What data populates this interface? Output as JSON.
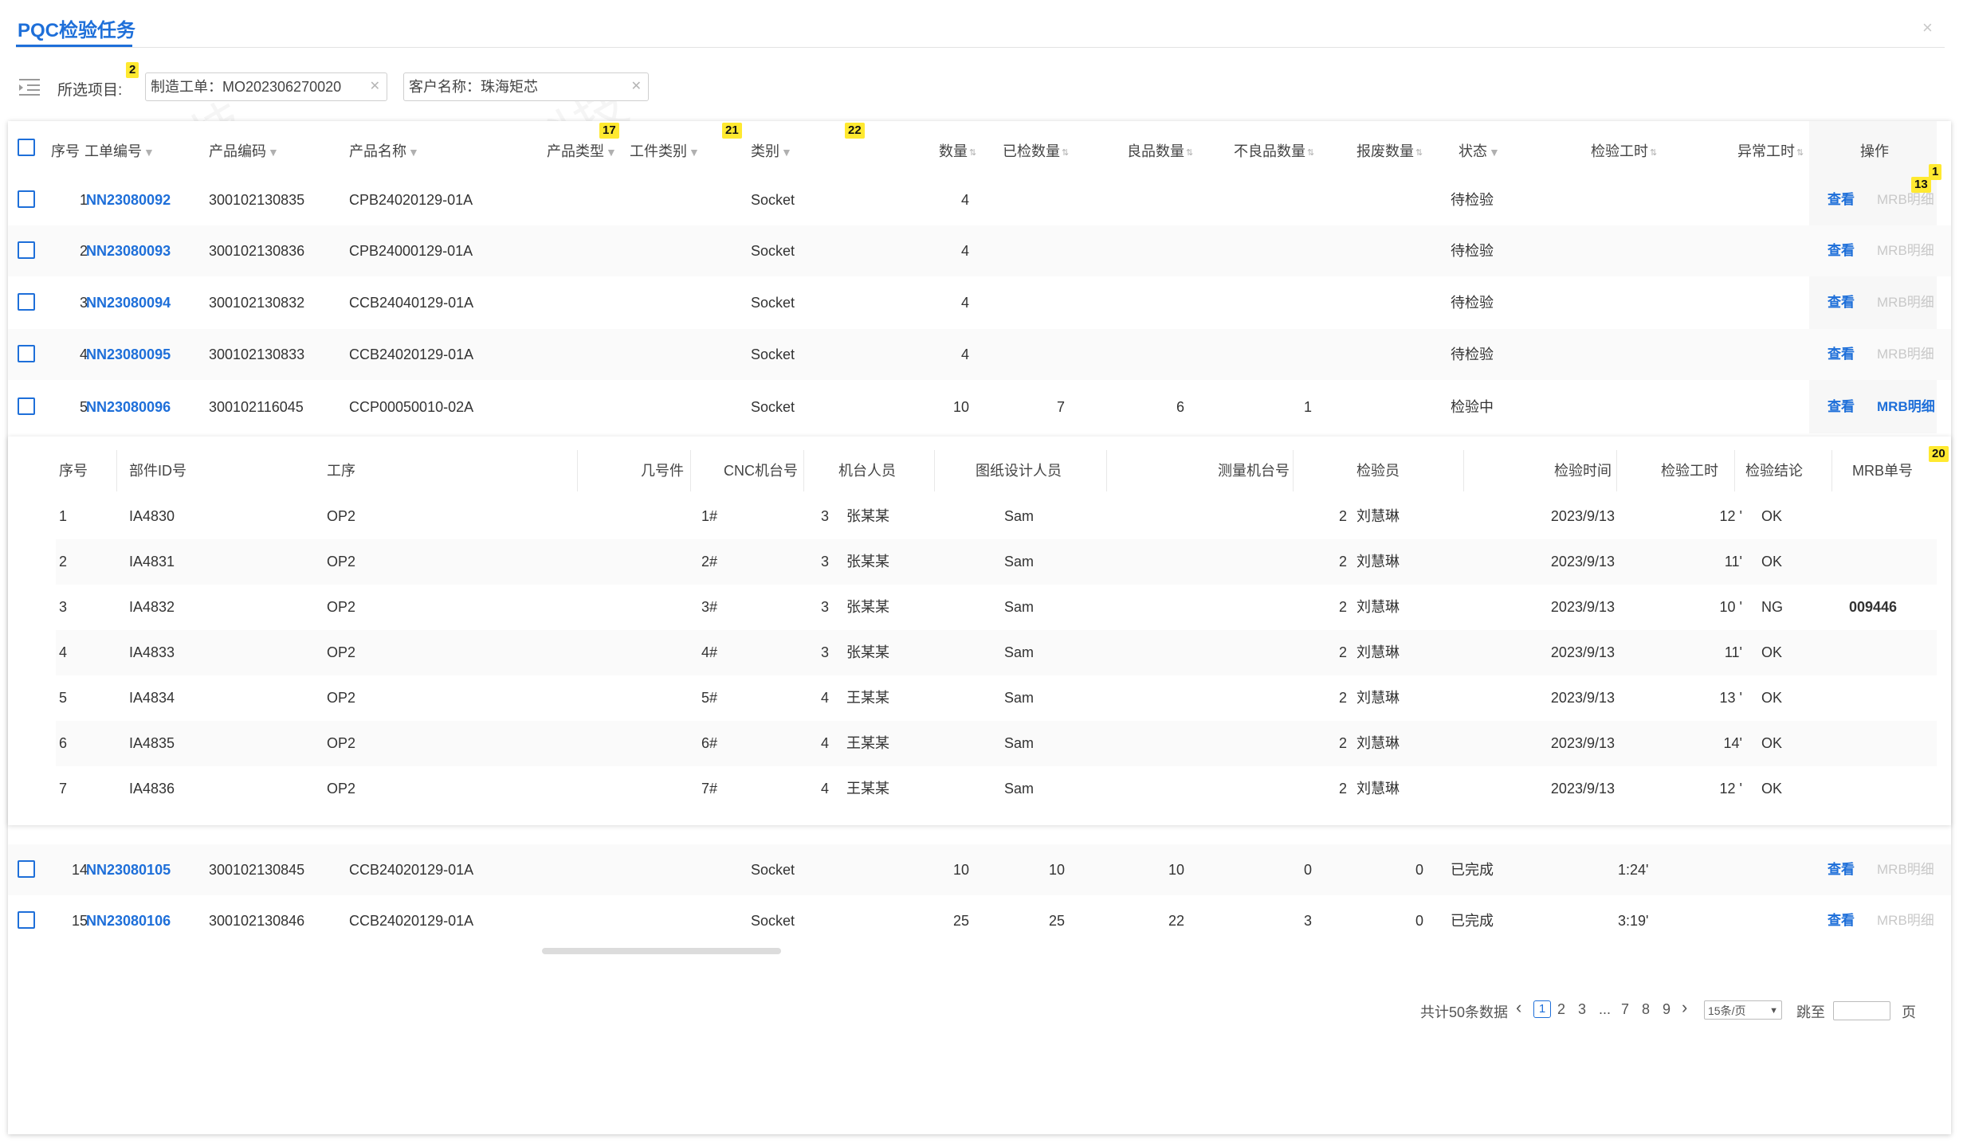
{
  "page": {
    "title": "PQC检验任务",
    "close": "×",
    "watermark": "晶棚科技"
  },
  "filter": {
    "label": "所选项目:",
    "chips": [
      {
        "text": "制造工单：MO202306270020"
      },
      {
        "text": "客户名称：珠海矩芯"
      }
    ]
  },
  "badges": {
    "b1": "1",
    "b2": "2",
    "b13": "13",
    "b17": "17",
    "b20": "20",
    "b21": "21",
    "b22": "22"
  },
  "table": {
    "headers": {
      "seq": "序号",
      "order_no": "工单编号",
      "product_code": "产品编码",
      "product_name": "产品名称",
      "product_type": "产品类型",
      "workpiece_type": "工件类别",
      "category": "类别",
      "qty": "数量",
      "inspected_qty": "已检数量",
      "good_qty": "良品数量",
      "bad_qty": "不良品数量",
      "scrap_qty": "报废数量",
      "status": "状态",
      "insp_hours": "检验工时",
      "abn_hours": "异常工时",
      "op": "操作"
    },
    "rows": [
      {
        "seq": "1",
        "order_no": "NN23080092",
        "product_code": "300102130835",
        "product_name": "CPB24020129-01A",
        "category": "Socket",
        "qty": "4",
        "inspected": "",
        "good": "",
        "bad": "",
        "scrap": "",
        "status": "待检验",
        "hours": "",
        "view": "查看",
        "mrb": "MRB明细"
      },
      {
        "seq": "2",
        "order_no": "NN23080093",
        "product_code": "300102130836",
        "product_name": "CPB24000129-01A",
        "category": "Socket",
        "qty": "4",
        "inspected": "",
        "good": "",
        "bad": "",
        "scrap": "",
        "status": "待检验",
        "hours": "",
        "view": "查看",
        "mrb": "MRB明细"
      },
      {
        "seq": "3",
        "order_no": "NN23080094",
        "product_code": "300102130832",
        "product_name": "CCB24040129-01A",
        "category": "Socket",
        "qty": "4",
        "inspected": "",
        "good": "",
        "bad": "",
        "scrap": "",
        "status": "待检验",
        "hours": "",
        "view": "查看",
        "mrb": "MRB明细"
      },
      {
        "seq": "4",
        "order_no": "NN23080095",
        "product_code": "300102130833",
        "product_name": "CCB24020129-01A",
        "category": "Socket",
        "qty": "4",
        "inspected": "",
        "good": "",
        "bad": "",
        "scrap": "",
        "status": "待检验",
        "hours": "",
        "view": "查看",
        "mrb": "MRB明细"
      },
      {
        "seq": "5",
        "order_no": "NN23080096",
        "product_code": "300102116045",
        "product_name": "CCP00050010-02A",
        "category": "Socket",
        "qty": "10",
        "inspected": "7",
        "good": "6",
        "bad": "1",
        "scrap": "",
        "status": "检验中",
        "hours": "",
        "view": "查看",
        "mrb": "MRB明细"
      },
      {
        "seq": "14",
        "order_no": "NN23080105",
        "product_code": "300102130845",
        "product_name": "CCB24020129-01A",
        "category": "Socket",
        "qty": "10",
        "inspected": "10",
        "good": "10",
        "bad": "0",
        "scrap": "0",
        "status": "已完成",
        "hours": "1:24'",
        "view": "查看",
        "mrb": "MRB明细"
      },
      {
        "seq": "15",
        "order_no": "NN23080106",
        "product_code": "300102130846",
        "product_name": "CCB24020129-01A",
        "category": "Socket",
        "qty": "25",
        "inspected": "25",
        "good": "22",
        "bad": "3",
        "scrap": "0",
        "status": "已完成",
        "hours": "3:19'",
        "view": "查看",
        "mrb": "MRB明细"
      }
    ]
  },
  "subtable": {
    "headers": {
      "seq": "序号",
      "part_id": "部件ID号",
      "process": "工序",
      "piece_no": "几号件",
      "cnc": "CNC机台号",
      "operator": "机台人员",
      "designer": "图纸设计人员",
      "meas": "测量机台号",
      "inspector": "检验员",
      "insp_time": "检验时间",
      "insp_hours": "检验工时",
      "conclusion": "检验结论",
      "mrb_no": "MRB单号"
    },
    "rows": [
      {
        "seq": "1",
        "part_id": "IA4830",
        "process": "OP2",
        "piece": "1#",
        "cnc": "3",
        "operator": "张某某",
        "designer": "Sam",
        "meas": "2",
        "inspector": "刘慧琳",
        "time": "2023/9/13",
        "hours": "12 '",
        "result": "OK",
        "mrb": ""
      },
      {
        "seq": "2",
        "part_id": "IA4831",
        "process": "OP2",
        "piece": "2#",
        "cnc": "3",
        "operator": "张某某",
        "designer": "Sam",
        "meas": "2",
        "inspector": "刘慧琳",
        "time": "2023/9/13",
        "hours": "11'",
        "result": "OK",
        "mrb": ""
      },
      {
        "seq": "3",
        "part_id": "IA4832",
        "process": "OP2",
        "piece": "3#",
        "cnc": "3",
        "operator": "张某某",
        "designer": "Sam",
        "meas": "2",
        "inspector": "刘慧琳",
        "time": "2023/9/13",
        "hours": "10 '",
        "result": "NG",
        "mrb": "009446"
      },
      {
        "seq": "4",
        "part_id": "IA4833",
        "process": "OP2",
        "piece": "4#",
        "cnc": "3",
        "operator": "张某某",
        "designer": "Sam",
        "meas": "2",
        "inspector": "刘慧琳",
        "time": "2023/9/13",
        "hours": "11'",
        "result": "OK",
        "mrb": ""
      },
      {
        "seq": "5",
        "part_id": "IA4834",
        "process": "OP2",
        "piece": "5#",
        "cnc": "4",
        "operator": "王某某",
        "designer": "Sam",
        "meas": "2",
        "inspector": "刘慧琳",
        "time": "2023/9/13",
        "hours": "13 '",
        "result": "OK",
        "mrb": ""
      },
      {
        "seq": "6",
        "part_id": "IA4835",
        "process": "OP2",
        "piece": "6#",
        "cnc": "4",
        "operator": "王某某",
        "designer": "Sam",
        "meas": "2",
        "inspector": "刘慧琳",
        "time": "2023/9/13",
        "hours": "14'",
        "result": "OK",
        "mrb": ""
      },
      {
        "seq": "7",
        "part_id": "IA4836",
        "process": "OP2",
        "piece": "7#",
        "cnc": "4",
        "operator": "王某某",
        "designer": "Sam",
        "meas": "2",
        "inspector": "刘慧琳",
        "time": "2023/9/13",
        "hours": "12 '",
        "result": "OK",
        "mrb": ""
      }
    ]
  },
  "pagination": {
    "total": "共计50条数据",
    "prev": "‹",
    "current": "1",
    "pages": [
      "2",
      "3",
      "...",
      "7",
      "8",
      "9"
    ],
    "next": "›",
    "page_size": "15条/页",
    "goto": "跳至",
    "page_unit": "页"
  },
  "colors": {
    "accent": "#1e6fd9",
    "badge": "#ffe930"
  }
}
